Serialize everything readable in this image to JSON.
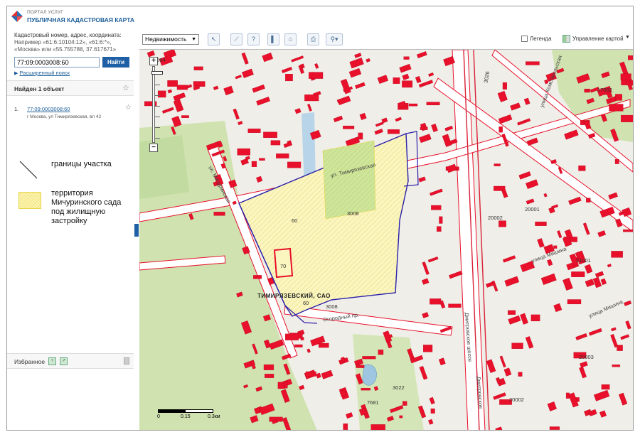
{
  "header": {
    "brand_top": "ПОРТАЛ УСЛУГ",
    "brand_main": "ПУБЛИЧНАЯ КАДАСТРОВАЯ КАРТА"
  },
  "search": {
    "hint_title": "Кадастровый номер, адрес, координата:",
    "hint_examples": "Например «61:6:10104:12», «61:6:*», «Москва» или «55.755788, 37.617671»",
    "value": "77:09:0003008:60",
    "find_label": "Найти",
    "advanced_label": "Расширенный поиск"
  },
  "results": {
    "title": "Найден 1 объект",
    "items": [
      {
        "num": "1.",
        "link": "77:09:0003008:60",
        "address": "г Москва, ул Тимирязевская, вл 42"
      }
    ]
  },
  "legend": {
    "line_label": "границы участка",
    "area_label": "территория Мичуринского сада под жилищную застройку"
  },
  "favorites": {
    "label": "Избранное"
  },
  "toolbar": {
    "layer": "Недвижимость",
    "legend_label": "Легенда",
    "map_manage_label": "Управление картой"
  },
  "map": {
    "scale": {
      "zero": "0",
      "mid": "0.15",
      "end": "0.3км"
    },
    "district_label": "ТИМИРЯЗЕВСКИЙ, САО",
    "labels": {
      "q3004": "3004",
      "q3008a": "3008",
      "q3008b": "3008",
      "n60a": "60",
      "n60b": "60",
      "n70": "70",
      "q17002": "17002",
      "q20001": "20001",
      "q20002a": "20002",
      "q20002b": "20002",
      "q21001": "21001",
      "q20003": "20003",
      "q3022": "3022",
      "n7681": "7681",
      "q3026": "3026"
    },
    "roads": {
      "timiryazevskaya": "ул. Тимирязевская",
      "dmitrovskoe": "Дмитровское шоссе",
      "dmitrovskoe2": "Дмитровское",
      "michurinsky": "ул. Мичуринская",
      "mishina": "улица Мишина",
      "mishina2": "улица Мишина",
      "ogorodny": "Огородный пр.",
      "komsomolskaya": "улица Комсомольская"
    }
  },
  "colors": {
    "accent": "#1f5fa5",
    "building": "#e8102a",
    "parcel_border": "#2a1fa8",
    "garden_fill": "#fbf3b0",
    "park": "#cfe2b0"
  }
}
